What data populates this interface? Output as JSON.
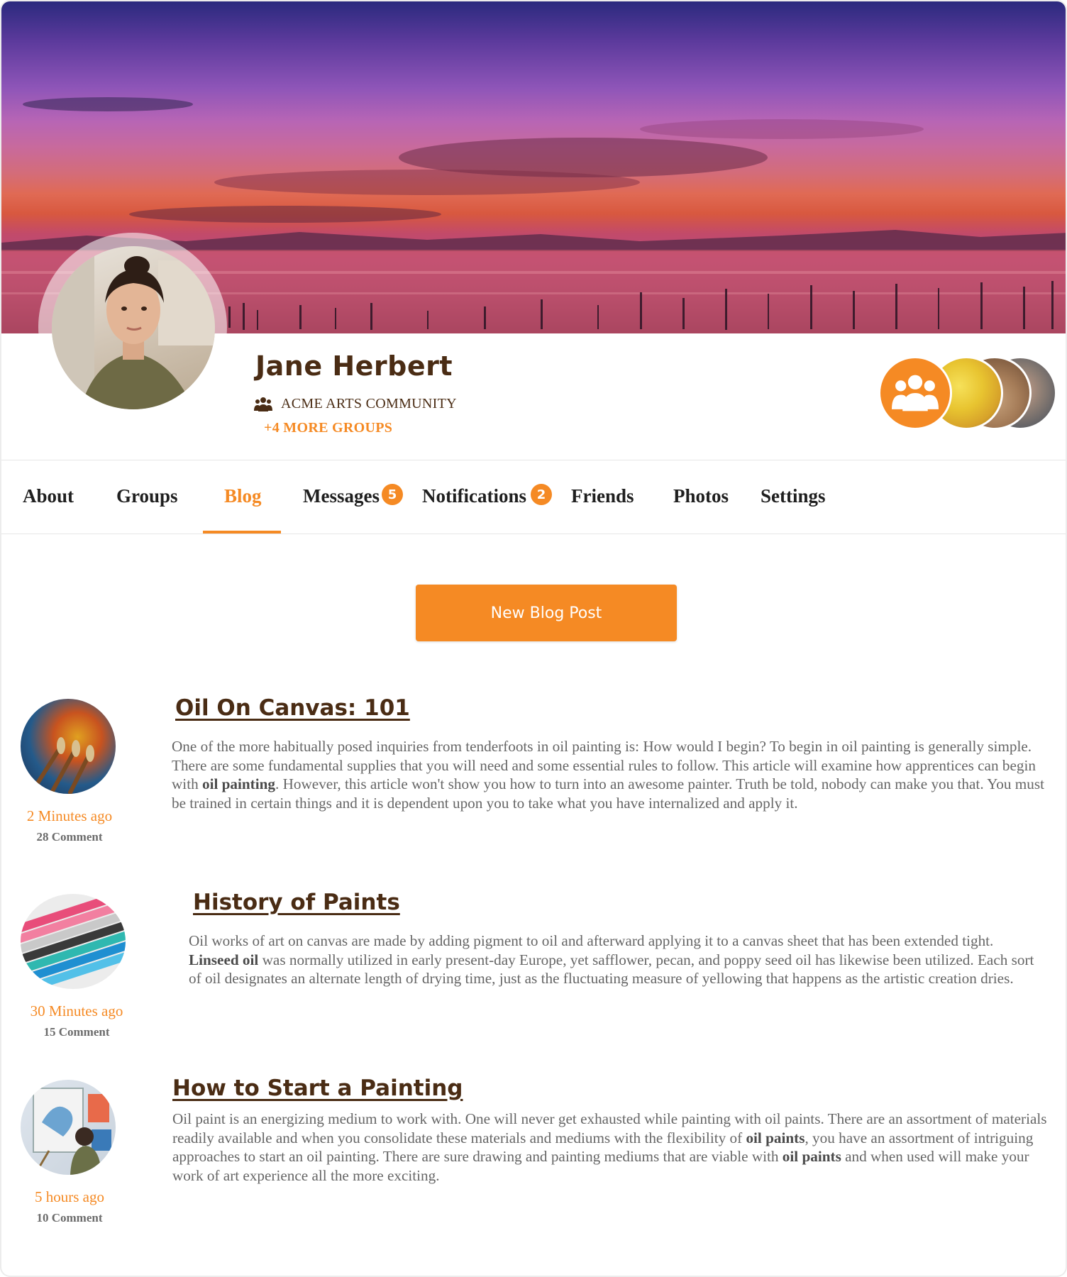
{
  "profile": {
    "name": "Jane Herbert",
    "group": "ACME ARTS COMMUNITY",
    "more_groups": "+4 MORE GROUPS"
  },
  "tabs": [
    {
      "label": "About"
    },
    {
      "label": "Groups"
    },
    {
      "label": "Blog",
      "active": true
    },
    {
      "label": "Messages",
      "badge": "5"
    },
    {
      "label": "Notifications",
      "badge": "2"
    },
    {
      "label": "Friends"
    },
    {
      "label": "Photos"
    },
    {
      "label": "Settings"
    }
  ],
  "actions": {
    "new_post_label": "New Blog Post"
  },
  "colors": {
    "accent": "#f58a24",
    "title_brown": "#4a2c14",
    "body_text": "#666666"
  },
  "icons": {
    "group_icon": "users-icon",
    "group_avatar": "users-icon"
  },
  "posts": [
    {
      "title": "Oil On Canvas: 101",
      "time": "2 Minutes ago",
      "comments": "28 Comment",
      "body_parts": [
        "One of the more habitually posed inquiries from tenderfoots in oil painting is: How would I begin? To begin in oil painting is generally simple. There are some fundamental supplies that you will need and some essential rules to follow. This article will examine how apprentices can begin with ",
        "oil painting",
        ". However, this article won't show you how to turn into an awesome painter. Truth be told, nobody can make you that. You must be trained in certain things and it is dependent upon you to take what you have internalized and apply it."
      ]
    },
    {
      "title": "History of Paints",
      "time": "30 Minutes ago",
      "comments": "15 Comment",
      "body_parts": [
        "Oil works of art on canvas are made by adding pigment to oil and afterward applying it to a canvas sheet that has been extended tight. ",
        "Linseed oil",
        " was normally utilized in early present-day Europe, yet safflower, pecan, and poppy seed oil has likewise been utilized. Each sort of oil designates an alternate length of drying time, just as the fluctuating measure of yellowing that happens as the artistic creation dries."
      ]
    },
    {
      "title": "How to Start a Painting",
      "time": "5 hours ago",
      "comments": "10 Comment",
      "body_parts": [
        "Oil paint is an energizing medium to work with. One will never get exhausted while painting with oil paints. There are an assortment of materials readily available and when you consolidate these materials and mediums with the flexibility of ",
        "oil paints",
        ", you have an assortment of intriguing approaches to start an oil painting. There are sure drawing and painting mediums that are viable with ",
        "oil paints",
        " and when used will make your work of art experience all the more exciting."
      ]
    }
  ]
}
